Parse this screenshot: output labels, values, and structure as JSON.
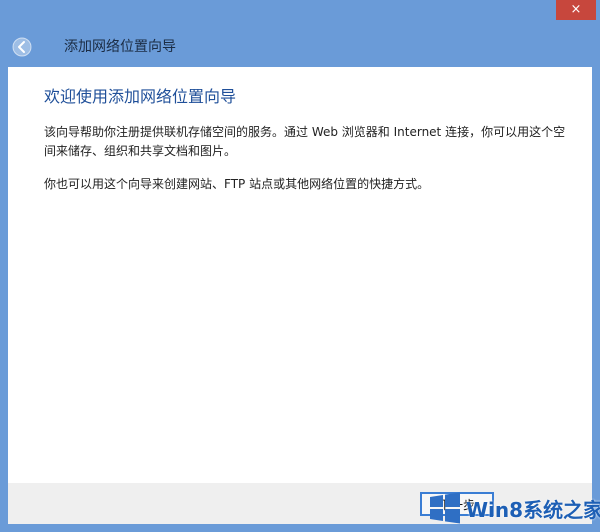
{
  "window": {
    "title": "添加网络位置向导",
    "close_glyph": "×"
  },
  "content": {
    "heading": "欢迎使用添加网络位置向导",
    "paragraph1": "该向导帮助你注册提供联机存储空间的服务。通过 Web 浏览器和 Internet 连接，你可以用这个空间来储存、组织和共享文档和图片。",
    "paragraph2": "你也可以用这个向导来创建网站、FTP 站点或其他网络位置的快捷方式。"
  },
  "footer": {
    "next_label": "下一步"
  },
  "watermark": {
    "text": "Win8系统之家",
    "logo": "windows-logo"
  },
  "colors": {
    "frame": "#6a9bd8",
    "close": "#c7473d",
    "heading": "#1f4f99",
    "accent": "#3b7ed4"
  }
}
